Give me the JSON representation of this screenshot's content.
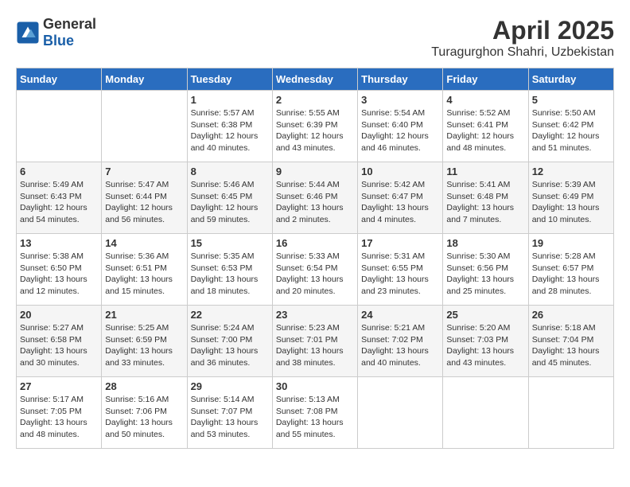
{
  "header": {
    "logo_general": "General",
    "logo_blue": "Blue",
    "month_title": "April 2025",
    "location": "Turagurghon Shahri, Uzbekistan"
  },
  "days_of_week": [
    "Sunday",
    "Monday",
    "Tuesday",
    "Wednesday",
    "Thursday",
    "Friday",
    "Saturday"
  ],
  "weeks": [
    [
      {
        "day": "",
        "info": ""
      },
      {
        "day": "",
        "info": ""
      },
      {
        "day": "1",
        "info": "Sunrise: 5:57 AM\nSunset: 6:38 PM\nDaylight: 12 hours\nand 40 minutes."
      },
      {
        "day": "2",
        "info": "Sunrise: 5:55 AM\nSunset: 6:39 PM\nDaylight: 12 hours\nand 43 minutes."
      },
      {
        "day": "3",
        "info": "Sunrise: 5:54 AM\nSunset: 6:40 PM\nDaylight: 12 hours\nand 46 minutes."
      },
      {
        "day": "4",
        "info": "Sunrise: 5:52 AM\nSunset: 6:41 PM\nDaylight: 12 hours\nand 48 minutes."
      },
      {
        "day": "5",
        "info": "Sunrise: 5:50 AM\nSunset: 6:42 PM\nDaylight: 12 hours\nand 51 minutes."
      }
    ],
    [
      {
        "day": "6",
        "info": "Sunrise: 5:49 AM\nSunset: 6:43 PM\nDaylight: 12 hours\nand 54 minutes."
      },
      {
        "day": "7",
        "info": "Sunrise: 5:47 AM\nSunset: 6:44 PM\nDaylight: 12 hours\nand 56 minutes."
      },
      {
        "day": "8",
        "info": "Sunrise: 5:46 AM\nSunset: 6:45 PM\nDaylight: 12 hours\nand 59 minutes."
      },
      {
        "day": "9",
        "info": "Sunrise: 5:44 AM\nSunset: 6:46 PM\nDaylight: 13 hours\nand 2 minutes."
      },
      {
        "day": "10",
        "info": "Sunrise: 5:42 AM\nSunset: 6:47 PM\nDaylight: 13 hours\nand 4 minutes."
      },
      {
        "day": "11",
        "info": "Sunrise: 5:41 AM\nSunset: 6:48 PM\nDaylight: 13 hours\nand 7 minutes."
      },
      {
        "day": "12",
        "info": "Sunrise: 5:39 AM\nSunset: 6:49 PM\nDaylight: 13 hours\nand 10 minutes."
      }
    ],
    [
      {
        "day": "13",
        "info": "Sunrise: 5:38 AM\nSunset: 6:50 PM\nDaylight: 13 hours\nand 12 minutes."
      },
      {
        "day": "14",
        "info": "Sunrise: 5:36 AM\nSunset: 6:51 PM\nDaylight: 13 hours\nand 15 minutes."
      },
      {
        "day": "15",
        "info": "Sunrise: 5:35 AM\nSunset: 6:53 PM\nDaylight: 13 hours\nand 18 minutes."
      },
      {
        "day": "16",
        "info": "Sunrise: 5:33 AM\nSunset: 6:54 PM\nDaylight: 13 hours\nand 20 minutes."
      },
      {
        "day": "17",
        "info": "Sunrise: 5:31 AM\nSunset: 6:55 PM\nDaylight: 13 hours\nand 23 minutes."
      },
      {
        "day": "18",
        "info": "Sunrise: 5:30 AM\nSunset: 6:56 PM\nDaylight: 13 hours\nand 25 minutes."
      },
      {
        "day": "19",
        "info": "Sunrise: 5:28 AM\nSunset: 6:57 PM\nDaylight: 13 hours\nand 28 minutes."
      }
    ],
    [
      {
        "day": "20",
        "info": "Sunrise: 5:27 AM\nSunset: 6:58 PM\nDaylight: 13 hours\nand 30 minutes."
      },
      {
        "day": "21",
        "info": "Sunrise: 5:25 AM\nSunset: 6:59 PM\nDaylight: 13 hours\nand 33 minutes."
      },
      {
        "day": "22",
        "info": "Sunrise: 5:24 AM\nSunset: 7:00 PM\nDaylight: 13 hours\nand 36 minutes."
      },
      {
        "day": "23",
        "info": "Sunrise: 5:23 AM\nSunset: 7:01 PM\nDaylight: 13 hours\nand 38 minutes."
      },
      {
        "day": "24",
        "info": "Sunrise: 5:21 AM\nSunset: 7:02 PM\nDaylight: 13 hours\nand 40 minutes."
      },
      {
        "day": "25",
        "info": "Sunrise: 5:20 AM\nSunset: 7:03 PM\nDaylight: 13 hours\nand 43 minutes."
      },
      {
        "day": "26",
        "info": "Sunrise: 5:18 AM\nSunset: 7:04 PM\nDaylight: 13 hours\nand 45 minutes."
      }
    ],
    [
      {
        "day": "27",
        "info": "Sunrise: 5:17 AM\nSunset: 7:05 PM\nDaylight: 13 hours\nand 48 minutes."
      },
      {
        "day": "28",
        "info": "Sunrise: 5:16 AM\nSunset: 7:06 PM\nDaylight: 13 hours\nand 50 minutes."
      },
      {
        "day": "29",
        "info": "Sunrise: 5:14 AM\nSunset: 7:07 PM\nDaylight: 13 hours\nand 53 minutes."
      },
      {
        "day": "30",
        "info": "Sunrise: 5:13 AM\nSunset: 7:08 PM\nDaylight: 13 hours\nand 55 minutes."
      },
      {
        "day": "",
        "info": ""
      },
      {
        "day": "",
        "info": ""
      },
      {
        "day": "",
        "info": ""
      }
    ]
  ]
}
